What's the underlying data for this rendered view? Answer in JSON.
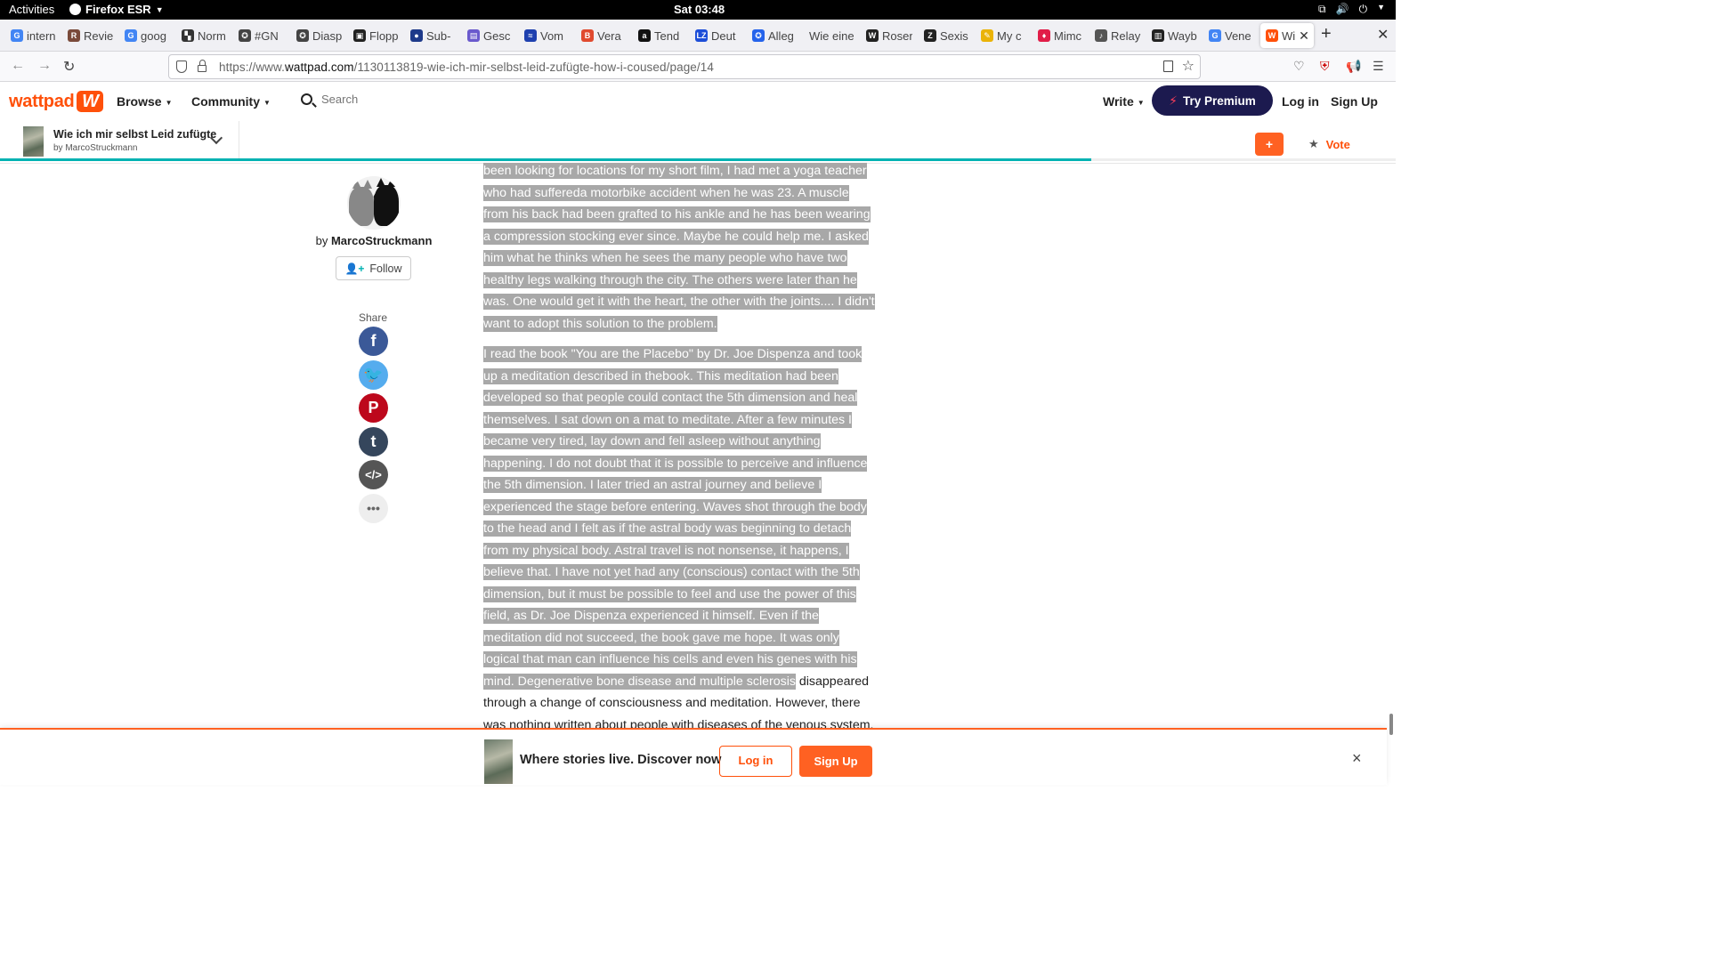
{
  "system": {
    "activities": "Activities",
    "app_name": "Firefox ESR",
    "clock": "Sat 03:48"
  },
  "tabs": [
    {
      "label": "intern",
      "favicon": "google-icon",
      "color": "#4285f4",
      "glyph": "G"
    },
    {
      "label": "Revie",
      "favicon": "review-icon",
      "color": "#7a4a3a",
      "glyph": "R"
    },
    {
      "label": "goog",
      "favicon": "google-icon",
      "color": "#4285f4",
      "glyph": "G"
    },
    {
      "label": "Norm",
      "favicon": "grid-icon",
      "color": "#333333",
      "glyph": "▚"
    },
    {
      "label": "#GN",
      "favicon": "mastodon-icon",
      "color": "#444444",
      "glyph": "✪"
    },
    {
      "label": "Diasp",
      "favicon": "diaspora-icon",
      "color": "#444444",
      "glyph": "✪"
    },
    {
      "label": "Flopp",
      "favicon": "floppy-icon",
      "color": "#222222",
      "glyph": "▣"
    },
    {
      "label": "Sub-",
      "favicon": "nasa-icon",
      "color": "#1e3a8a",
      "glyph": "●"
    },
    {
      "label": "Gesc",
      "favicon": "book-icon",
      "color": "#6a5acd",
      "glyph": "▤"
    },
    {
      "label": "Vom",
      "favicon": "chart-icon",
      "color": "#1e40af",
      "glyph": "≈"
    },
    {
      "label": "Vera",
      "favicon": "bc-icon",
      "color": "#e04a2f",
      "glyph": "B"
    },
    {
      "label": "Tend",
      "favicon": "amazon-icon",
      "color": "#111111",
      "glyph": "a"
    },
    {
      "label": "Deut",
      "favicon": "lz-icon",
      "color": "#1d4ed8",
      "glyph": "LZ"
    },
    {
      "label": "Alleg",
      "favicon": "badge-icon",
      "color": "#2563eb",
      "glyph": "✪"
    },
    {
      "label": "Wie eine",
      "favicon": "none",
      "color": "#f0f0f4",
      "glyph": ""
    },
    {
      "label": "Roser",
      "favicon": "wikipedia-icon",
      "color": "#222222",
      "glyph": "W"
    },
    {
      "label": "Sexis",
      "favicon": "z-icon",
      "color": "#222222",
      "glyph": "Z"
    },
    {
      "label": "My c",
      "favicon": "sticky-icon",
      "color": "#eab308",
      "glyph": "✎"
    },
    {
      "label": "Mimc",
      "favicon": "flame-icon",
      "color": "#e11d48",
      "glyph": "♦"
    },
    {
      "label": "Relay",
      "favicon": "relay-icon",
      "color": "#555555",
      "glyph": "♪"
    },
    {
      "label": "Wayb",
      "favicon": "archive-icon",
      "color": "#222222",
      "glyph": "▥"
    },
    {
      "label": "Vene",
      "favicon": "google-icon",
      "color": "#4285f4",
      "glyph": "G"
    },
    {
      "label": "Wi",
      "favicon": "wattpad-icon",
      "color": "#ff500a",
      "glyph": "W",
      "active": true
    }
  ],
  "nav": {
    "url_prefix": "https://www.",
    "url_domain": "wattpad.com",
    "url_path": "/1130113819-wie-ich-mir-selbst-leid-zufügte-how-i-coused/page/14"
  },
  "header": {
    "logo_text": "wattpad",
    "browse": "Browse",
    "community": "Community",
    "search_placeholder": "Search",
    "write": "Write",
    "premium": "Try Premium",
    "login": "Log in",
    "signup": "Sign Up"
  },
  "story_bar": {
    "title": "Wie ich mir selbst Leid zufügte",
    "author": "by MarcoStruckmann",
    "add_label": "+",
    "vote_label": "Vote",
    "progress": 0.782
  },
  "author": {
    "by": "by",
    "name": "MarcoStruckmann",
    "follow": "Follow",
    "share_label": "Share",
    "share_buttons": [
      {
        "name": "facebook-share-button",
        "icon": "facebook-icon",
        "glyph": "f",
        "color": "#3b5998"
      },
      {
        "name": "twitter-share-button",
        "icon": "twitter-icon",
        "glyph": "🐦",
        "color": "#55acee"
      },
      {
        "name": "pinterest-share-button",
        "icon": "pinterest-icon",
        "glyph": "P",
        "color": "#bd081c"
      },
      {
        "name": "tumblr-share-button",
        "icon": "tumblr-icon",
        "glyph": "t",
        "color": "#35465c"
      },
      {
        "name": "embed-share-button",
        "icon": "code-icon",
        "glyph": "</>",
        "color": "#555555"
      },
      {
        "name": "more-share-button",
        "icon": "more-icon",
        "glyph": "•••",
        "color": "#eeeeee"
      }
    ]
  },
  "story_text": {
    "p1_highlighted": "been looking for locations for my short film, I had met a yoga teacher who had suffereda motorbike accident when he was 23. A muscle from his back had been grafted to his ankle and he has been wearing a compression stocking ever since. Maybe he could help me. I asked him what he thinks when he sees the many people who have two healthy legs walking through the city. The others were later than he was. One would get it with the heart, the other with the joints.... I didn't want to adopt this solution to the problem.",
    "p2_highlighted": "I read the book \"You are the Placebo\" by Dr. Joe Dispenza and took up a meditation described in thebook. This meditation had been developed so that people could contact the 5th dimension and heal themselves. I sat down on a mat to meditate. After a few minutes I became very tired, lay down and fell asleep without anything happening. I do not doubt that it is possible to perceive and influence the 5th dimension. I later tried an astral journey and believe I experienced the stage before entering. Waves shot through the body to the head and I felt as if the astral body was beginning to detach from my physical body. Astral travel is not nonsense, it happens, I believe that. I have not yet had any (conscious) contact with the 5th dimension, but it must be possible to feel and use the power of this field, as Dr. Joe Dispenza experienced it himself. Even if the meditation did not succeed, the book gave me hope. It was only logical that man can influence his cells and even his genes with his mind. Degenerative bone disease and multiple sclerosis",
    "p2_plain": " disappeared through a change of consciousness and meditation. However, there was nothing written about people with diseases of the venous system. This discouraged me. At the same time, I tried \"honest"
  },
  "banner": {
    "tagline": "Where stories live. Discover now",
    "login": "Log in",
    "signup": "Sign Up",
    "close": "×"
  },
  "colors": {
    "brand": "#ff500a",
    "premium": "#1c1a4f",
    "progress": "#00b2b2",
    "selection": "#a8a8a8"
  }
}
